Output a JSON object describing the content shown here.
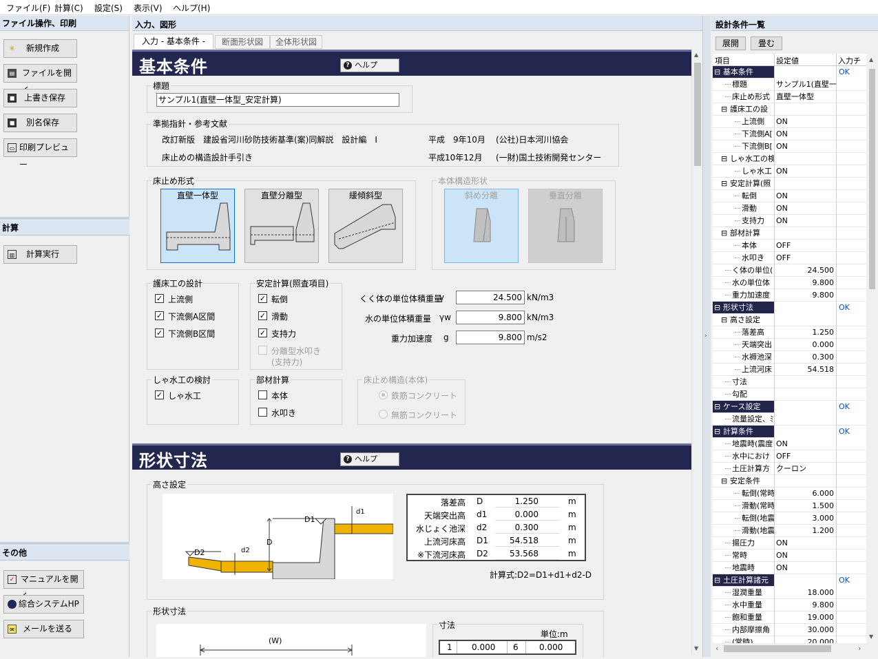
{
  "menu": [
    "ファイル(F)",
    "計算(C)",
    "設定(S)",
    "表示(V)",
    "ヘルプ(H)"
  ],
  "left": {
    "file_hdr": "ファイル操作、印刷",
    "file_buttons": [
      {
        "label": "新規作成",
        "icon": "new-icon"
      },
      {
        "label": "ファイルを開く",
        "icon": "open-icon"
      },
      {
        "label": "上書き保存",
        "icon": "save-icon"
      },
      {
        "label": "別名保存",
        "icon": "save-as-icon"
      },
      {
        "label": "印刷プレビュー",
        "icon": "print-icon"
      }
    ],
    "calc_hdr": "計算",
    "calc_button": "計算実行",
    "other_hdr": "その他",
    "other_buttons": [
      "マニュアルを開く",
      "綜合システムHP",
      "メールを送る"
    ]
  },
  "center": {
    "hdr": "入力、図形",
    "tabs": [
      "入力 - 基本条件 -",
      "断面形状図",
      "全体形状図"
    ],
    "sec1": "基本条件",
    "help": "ヘルプ",
    "title_label": "標題",
    "title_value": "サンプル1(直壁一体型_安定計算)",
    "ref_label": "準拠指針・参考文献",
    "refs": [
      {
        "name": "改訂新版　建設省河川砂防技術基準(案)同解説　設計編　Ⅰ",
        "date": "平成　9年10月",
        "org": "(公社)日本河川協会"
      },
      {
        "name": "床止めの構造設計手引き",
        "date": "平成10年12月",
        "org": "(一財)国土技術開発センター"
      }
    ],
    "shape_label": "床止め形式",
    "shapes": [
      "直壁一体型",
      "直壁分離型",
      "緩傾斜型"
    ],
    "body_label": "本体構造形状",
    "body_shapes": [
      "斜め分離",
      "垂直分離"
    ],
    "gosho_label": "護床工の設計",
    "gosho": [
      "上流側",
      "下流側A区間",
      "下流側B区間"
    ],
    "anzen_label": "安定計算(照査項目)",
    "anzen": [
      "転倒",
      "滑動",
      "支持力"
    ],
    "anzen_dis": [
      "分離型水叩き",
      "(支持力)"
    ],
    "params": [
      {
        "label": "くく体の単位体積重量",
        "sym": "γ",
        "value": "24.500",
        "unit": "kN/m3"
      },
      {
        "label": "水の単位体積重量",
        "sym": "γw",
        "value": "9.800",
        "unit": "kN/m3"
      },
      {
        "label": "重力加速度",
        "sym": "g",
        "value": "9.800",
        "unit": "m/s2"
      }
    ],
    "shasui_label": "しゃ水工の検討",
    "shasui": "しゃ水工",
    "buzai_label": "部材計算",
    "buzai": [
      "本体",
      "水叩き"
    ],
    "kozo_label": "床止め構造(本体)",
    "kozo": [
      "鉄筋コンクリート",
      "無筋コンクリート"
    ],
    "sec2": "形状寸法",
    "height_label": "高さ設定",
    "heights": [
      {
        "name": "落差高",
        "sym": "D",
        "value": "1.250",
        "unit": "m"
      },
      {
        "name": "天端突出高",
        "sym": "d1",
        "value": "0.000",
        "unit": "m"
      },
      {
        "name": "水じょく池深",
        "sym": "d2",
        "value": "0.300",
        "unit": "m"
      },
      {
        "name": "上流河床高",
        "sym": "D1",
        "value": "54.518",
        "unit": "m"
      },
      {
        "name": "※下流河床高",
        "sym": "D2",
        "value": "53.568",
        "unit": "m"
      }
    ],
    "formula": "計算式:D2=D1+d1+d2-D",
    "dim_label": "形状寸法",
    "w_label": "(W)",
    "dim_sub": "寸法",
    "unit_label": "単位:m",
    "dim_row": [
      "1",
      "0.000",
      "6",
      "0.000"
    ],
    "diag": {
      "D": "D",
      "D1": "D1",
      "D2": "D2",
      "d1": "d1",
      "d2": "d2"
    }
  },
  "right": {
    "hdr": "設計条件一覧",
    "btn_expand": "展開",
    "btn_collapse": "畳む",
    "cols": [
      "項目",
      "設定値",
      "入力チェ"
    ],
    "rows": [
      {
        "l": 0,
        "t": "基本条件",
        "v": "",
        "c": "OK",
        "h": true
      },
      {
        "l": 1,
        "t": "標題",
        "v": "サンプル1(直壁一",
        "c": ""
      },
      {
        "l": 1,
        "t": "床止め形式",
        "v": "直壁一体型",
        "c": ""
      },
      {
        "l": 1,
        "t": "護床工の設",
        "v": "",
        "c": "",
        "g": true
      },
      {
        "l": 2,
        "t": "上流側",
        "v": "ON",
        "c": ""
      },
      {
        "l": 2,
        "t": "下流側A[",
        "v": "ON",
        "c": ""
      },
      {
        "l": 2,
        "t": "下流側B[",
        "v": "ON",
        "c": ""
      },
      {
        "l": 1,
        "t": "しゃ水工の検",
        "v": "",
        "c": "",
        "g": true
      },
      {
        "l": 2,
        "t": "しゃ水工",
        "v": "ON",
        "c": ""
      },
      {
        "l": 1,
        "t": "安定計算(照",
        "v": "",
        "c": "",
        "g": true
      },
      {
        "l": 2,
        "t": "転倒",
        "v": "ON",
        "c": ""
      },
      {
        "l": 2,
        "t": "滑動",
        "v": "ON",
        "c": ""
      },
      {
        "l": 2,
        "t": "支持力",
        "v": "ON",
        "c": ""
      },
      {
        "l": 1,
        "t": "部材計算",
        "v": "",
        "c": "",
        "g": true
      },
      {
        "l": 2,
        "t": "本体",
        "v": "OFF",
        "c": ""
      },
      {
        "l": 2,
        "t": "水叩き",
        "v": "OFF",
        "c": ""
      },
      {
        "l": 1,
        "t": "く体の単位(",
        "v": "24.500",
        "c": "",
        "n": true
      },
      {
        "l": 1,
        "t": "水の単位体",
        "v": "9.800",
        "c": "",
        "n": true
      },
      {
        "l": 1,
        "t": "重力加速度",
        "v": "9.800",
        "c": "",
        "n": true
      },
      {
        "l": 0,
        "t": "形状寸法",
        "v": "",
        "c": "OK",
        "h": true
      },
      {
        "l": 1,
        "t": "高さ設定",
        "v": "",
        "c": "",
        "g": true
      },
      {
        "l": 2,
        "t": "落差高",
        "v": "1.250",
        "c": "",
        "n": true
      },
      {
        "l": 2,
        "t": "天端突出",
        "v": "0.000",
        "c": "",
        "n": true
      },
      {
        "l": 2,
        "t": "水褥池深",
        "v": "0.300",
        "c": "",
        "n": true
      },
      {
        "l": 2,
        "t": "上流河床",
        "v": "54.518",
        "c": "",
        "n": true
      },
      {
        "l": 1,
        "t": "寸法",
        "v": "",
        "c": ""
      },
      {
        "l": 1,
        "t": "勾配",
        "v": "",
        "c": ""
      },
      {
        "l": 0,
        "t": "ケース設定",
        "v": "",
        "c": "OK",
        "h": true
      },
      {
        "l": 1,
        "t": "流量設定、ﾐ",
        "v": "",
        "c": ""
      },
      {
        "l": 0,
        "t": "計算条件",
        "v": "",
        "c": "OK",
        "h": true
      },
      {
        "l": 1,
        "t": "地震時(震度",
        "v": "ON",
        "c": ""
      },
      {
        "l": 1,
        "t": "水中におけ",
        "v": "OFF",
        "c": ""
      },
      {
        "l": 1,
        "t": "土圧計算方",
        "v": "クーロン",
        "c": ""
      },
      {
        "l": 1,
        "t": "安定条件",
        "v": "",
        "c": "",
        "g": true
      },
      {
        "l": 2,
        "t": "転倒(常時",
        "v": "6.000",
        "c": "",
        "n": true
      },
      {
        "l": 2,
        "t": "滑動(常時",
        "v": "1.500",
        "c": "",
        "n": true
      },
      {
        "l": 2,
        "t": "転倒(地震",
        "v": "3.000",
        "c": "",
        "n": true
      },
      {
        "l": 2,
        "t": "滑動(地震",
        "v": "1.200",
        "c": "",
        "n": true
      },
      {
        "l": 1,
        "t": "揚圧力",
        "v": "ON",
        "c": ""
      },
      {
        "l": 1,
        "t": "常時",
        "v": "ON",
        "c": ""
      },
      {
        "l": 1,
        "t": "地震時",
        "v": "ON",
        "c": ""
      },
      {
        "l": 0,
        "t": "土圧計算諸元",
        "v": "",
        "c": "OK",
        "h": true
      },
      {
        "l": 1,
        "t": "湿潤重量",
        "v": "18.000",
        "c": "",
        "n": true
      },
      {
        "l": 1,
        "t": "水中重量",
        "v": "9.800",
        "c": "",
        "n": true
      },
      {
        "l": 1,
        "t": "飽和重量",
        "v": "19.000",
        "c": "",
        "n": true
      },
      {
        "l": 1,
        "t": "内部摩擦角",
        "v": "30.000",
        "c": "",
        "n": true
      },
      {
        "l": 1,
        "t": "(常時)",
        "v": "20.000",
        "c": "",
        "n": true
      }
    ]
  }
}
